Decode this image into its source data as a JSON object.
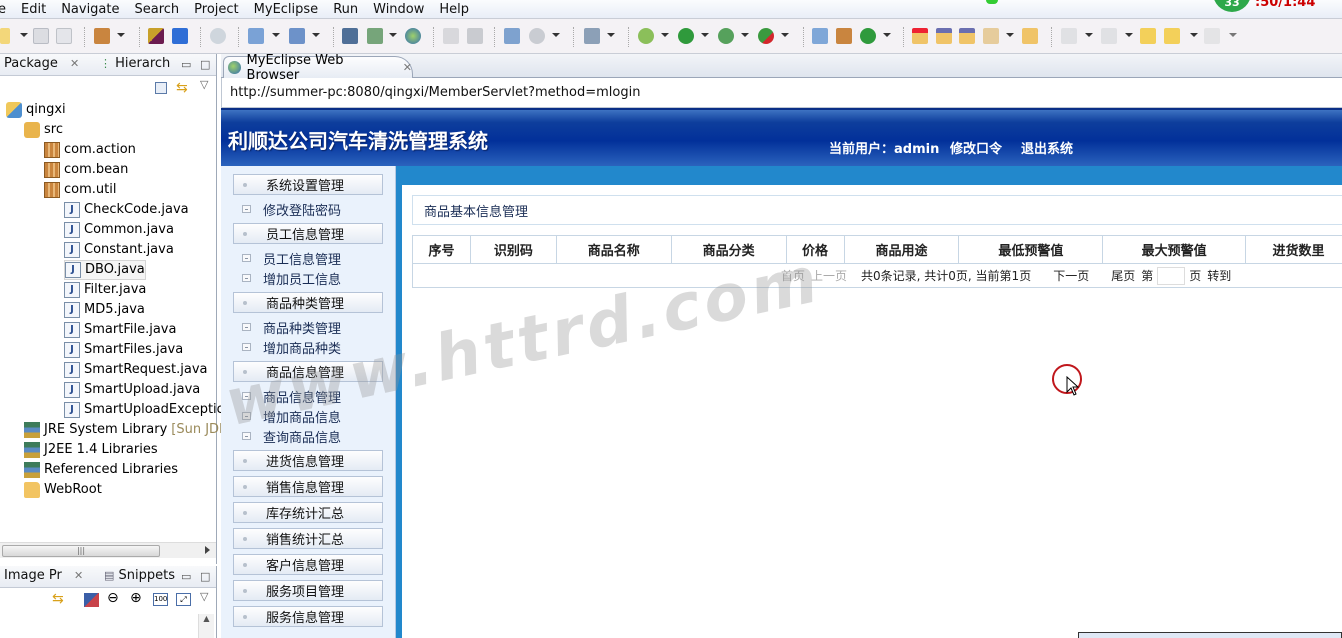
{
  "menubar": {
    "items": [
      "e",
      "Edit",
      "Navigate",
      "Search",
      "Project",
      "MyEclipse",
      "Run",
      "Window",
      "Help"
    ]
  },
  "recorder": {
    "badge": "33",
    "time": ":50/1:44"
  },
  "left_panel": {
    "tabs": [
      {
        "label": "Package",
        "active": true
      },
      {
        "label": "Hierarch",
        "active": false
      }
    ],
    "tree": [
      {
        "label": "qingxi",
        "icon": "project-icon",
        "depth": 0
      },
      {
        "label": "src",
        "icon": "source-folder-icon",
        "depth": 1
      },
      {
        "label": "com.action",
        "icon": "package-icon",
        "depth": 2
      },
      {
        "label": "com.bean",
        "icon": "package-icon",
        "depth": 2
      },
      {
        "label": "com.util",
        "icon": "package-icon",
        "depth": 2
      },
      {
        "label": "CheckCode.java",
        "icon": "java-file-icon",
        "depth": 3
      },
      {
        "label": "Common.java",
        "icon": "java-file-icon",
        "depth": 3
      },
      {
        "label": "Constant.java",
        "icon": "java-file-icon",
        "depth": 3
      },
      {
        "label": "DBO.java",
        "icon": "java-file-icon",
        "depth": 3,
        "selected": true
      },
      {
        "label": "Filter.java",
        "icon": "java-file-icon",
        "depth": 3
      },
      {
        "label": "MD5.java",
        "icon": "java-file-icon",
        "depth": 3
      },
      {
        "label": "SmartFile.java",
        "icon": "java-file-icon",
        "depth": 3
      },
      {
        "label": "SmartFiles.java",
        "icon": "java-file-icon",
        "depth": 3
      },
      {
        "label": "SmartRequest.java",
        "icon": "java-file-icon",
        "depth": 3
      },
      {
        "label": "SmartUpload.java",
        "icon": "java-file-icon",
        "depth": 3
      },
      {
        "label": "SmartUploadException",
        "icon": "java-file-icon",
        "depth": 3
      },
      {
        "label": "JRE System Library",
        "suffix": "[Sun JDK :",
        "icon": "library-icon",
        "depth": 1
      },
      {
        "label": "J2EE 1.4 Libraries",
        "icon": "library-icon",
        "depth": 1
      },
      {
        "label": "Referenced Libraries",
        "icon": "library-icon",
        "depth": 1
      },
      {
        "label": "WebRoot",
        "icon": "folder-icon",
        "depth": 1
      }
    ]
  },
  "bottom_left_panel": {
    "tabs": [
      {
        "label": "Image Pr",
        "active": true
      },
      {
        "label": "Snippets",
        "active": false
      }
    ]
  },
  "editor": {
    "tab_label": "MyEclipse Web Browser",
    "url": "http://summer-pc:8080/qingxi/MemberServlet?method=mlogin"
  },
  "webpage": {
    "title": "利顺达公司汽车清洗管理系统",
    "current_user_label": "当前用户：",
    "current_user": "admin",
    "change_password": "修改口令",
    "logout": "退出系统",
    "nav": [
      {
        "type": "group",
        "label": "系统设置管理"
      },
      {
        "type": "item",
        "label": "修改登陆密码"
      },
      {
        "type": "group",
        "label": "员工信息管理"
      },
      {
        "type": "item",
        "label": "员工信息管理"
      },
      {
        "type": "item",
        "label": "增加员工信息"
      },
      {
        "type": "group",
        "label": "商品种类管理"
      },
      {
        "type": "item",
        "label": "商品种类管理"
      },
      {
        "type": "item",
        "label": "增加商品种类"
      },
      {
        "type": "group",
        "label": "商品信息管理"
      },
      {
        "type": "item",
        "label": "商品信息管理"
      },
      {
        "type": "item",
        "label": "增加商品信息"
      },
      {
        "type": "item",
        "label": "查询商品信息"
      },
      {
        "type": "group",
        "label": "进货信息管理"
      },
      {
        "type": "group",
        "label": "销售信息管理"
      },
      {
        "type": "group",
        "label": "库存统计汇总"
      },
      {
        "type": "group",
        "label": "销售统计汇总"
      },
      {
        "type": "group",
        "label": "客户信息管理"
      },
      {
        "type": "group",
        "label": "服务项目管理"
      },
      {
        "type": "group",
        "label": "服务信息管理"
      }
    ],
    "section_title": "商品基本信息管理",
    "table": {
      "columns": [
        "序号",
        "识别码",
        "商品名称",
        "商品分类",
        "价格",
        "商品用途",
        "最低预警值",
        "最大预警值",
        "进货数里"
      ],
      "rows": []
    },
    "pager": {
      "first": "首页",
      "prev": "上一页",
      "summary": "共0条记录, 共计0页, 当前第1页",
      "next": "下一页",
      "last": "尾页",
      "goto_prefix": "第",
      "goto_input": "",
      "goto_suffix": "页",
      "goto_button": "转到"
    }
  },
  "watermark": "www.httrd.com"
}
